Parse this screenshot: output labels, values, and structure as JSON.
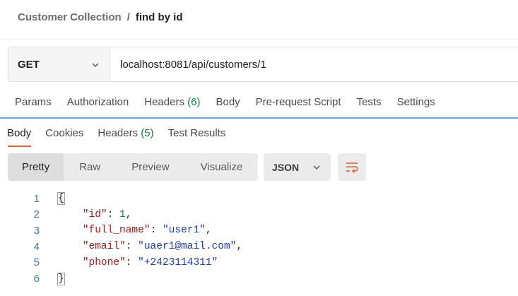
{
  "breadcrumb": {
    "collection": "Customer Collection",
    "separator": "/",
    "request": "find by id"
  },
  "request": {
    "method": "GET",
    "url": "localhost:8081/api/customers/1"
  },
  "request_tabs": [
    {
      "label": "Params",
      "count": ""
    },
    {
      "label": "Authorization",
      "count": ""
    },
    {
      "label": "Headers",
      "count": "(6)"
    },
    {
      "label": "Body",
      "count": ""
    },
    {
      "label": "Pre-request Script",
      "count": ""
    },
    {
      "label": "Tests",
      "count": ""
    },
    {
      "label": "Settings",
      "count": ""
    }
  ],
  "response_tabs": [
    {
      "label": "Body",
      "count": "",
      "active": true
    },
    {
      "label": "Cookies",
      "count": "",
      "active": false
    },
    {
      "label": "Headers",
      "count": "(5)",
      "active": false
    },
    {
      "label": "Test Results",
      "count": "",
      "active": false
    }
  ],
  "view_modes": [
    {
      "label": "Pretty",
      "active": true
    },
    {
      "label": "Raw",
      "active": false
    },
    {
      "label": "Preview",
      "active": false
    },
    {
      "label": "Visualize",
      "active": false
    }
  ],
  "format": "JSON",
  "icons": {
    "method_dropdown": "chevron-down-icon",
    "format_dropdown": "chevron-down-icon",
    "wrap": "wrap-lines-icon"
  },
  "colors": {
    "accent": "#e8632b",
    "count_green": "#0a8a3e",
    "divider_blue": "#6aa2df",
    "json_key": "#a01919",
    "json_string": "#1f3fa8",
    "json_number": "#1a8a4a",
    "line_number": "#3c7a9a"
  },
  "code_lines": [
    {
      "n": "1",
      "indent": "",
      "brace": "{"
    },
    {
      "n": "2",
      "indent": "    ",
      "key": "\"id\"",
      "sep": ": ",
      "value": "1",
      "vtype": "num",
      "tail": ","
    },
    {
      "n": "3",
      "indent": "    ",
      "key": "\"full_name\"",
      "sep": ": ",
      "value": "\"user1\"",
      "vtype": "str",
      "tail": ","
    },
    {
      "n": "4",
      "indent": "    ",
      "key": "\"email\"",
      "sep": ": ",
      "value": "\"uaer1@mail.com\"",
      "vtype": "str",
      "tail": ","
    },
    {
      "n": "5",
      "indent": "    ",
      "key": "\"phone\"",
      "sep": ": ",
      "value": "\"+2423114311\"",
      "vtype": "str",
      "tail": ""
    },
    {
      "n": "6",
      "indent": "",
      "brace": "}"
    }
  ]
}
